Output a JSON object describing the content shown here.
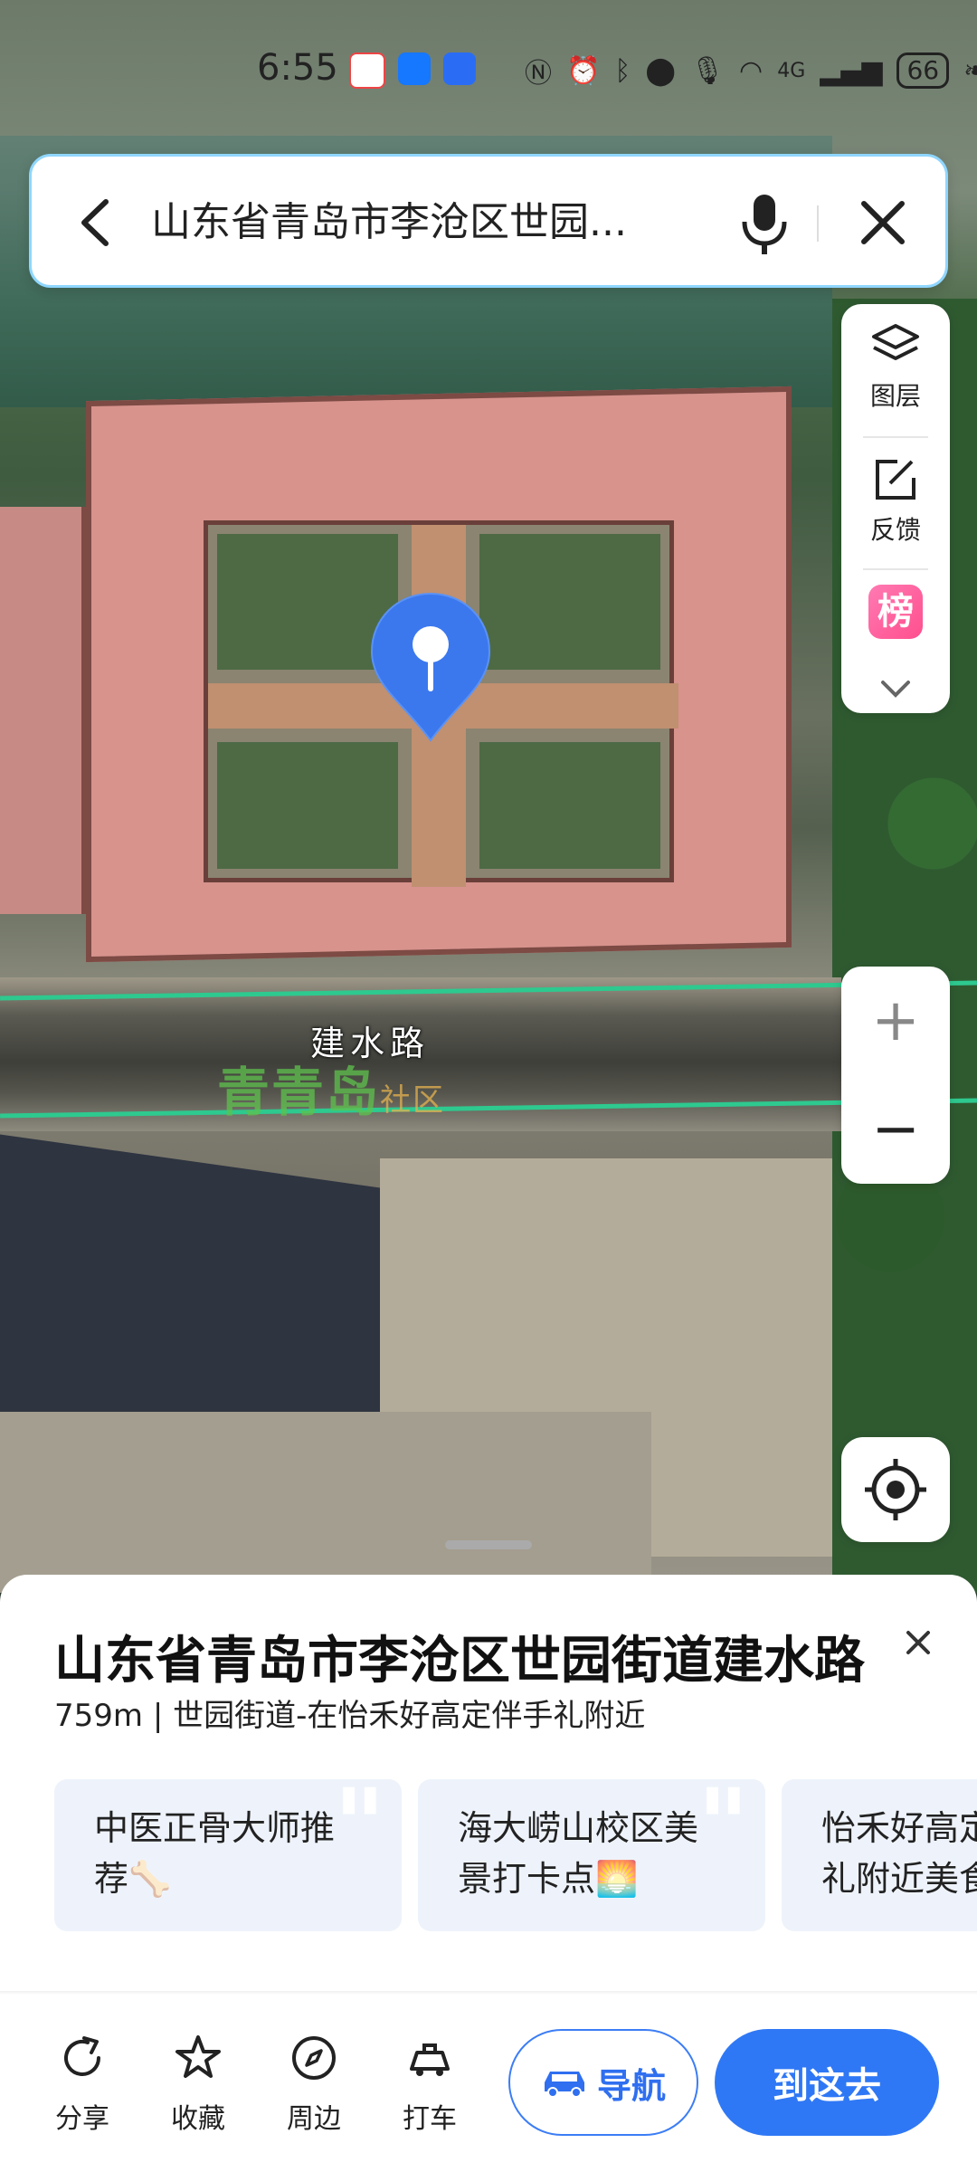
{
  "status_bar": {
    "time": "6:55",
    "network": "4G",
    "battery": "66"
  },
  "search": {
    "query": "山东省青岛市李沧区世园...",
    "back_icon": "chevron-left-icon",
    "voice_icon": "microphone-icon",
    "clear_icon": "close-icon"
  },
  "map": {
    "road_label": "建水路",
    "watermark_main": "青青岛",
    "watermark_small": "社区"
  },
  "tools": {
    "layers_label": "图层",
    "feedback_label": "反馈",
    "rank_badge": "榜"
  },
  "zoom": {
    "in": "+",
    "out": "−"
  },
  "poi": {
    "title": "山东省青岛市李沧区世园街道建水路",
    "subtitle": "759m | 世园街道-在怡禾好高定伴手礼附近",
    "cards": [
      {
        "text": "中医正骨大师推荐🦴"
      },
      {
        "text": "海大崂山校区美景打卡点🌅"
      },
      {
        "text": "怡禾好高定伴手礼附近美食"
      }
    ]
  },
  "actions": {
    "share": "分享",
    "favorite": "收藏",
    "nearby": "周边",
    "taxi": "打车",
    "navigate": "导航",
    "go_here": "到这去"
  },
  "colors": {
    "accent": "#2f78f5",
    "route_line": "#2ec98f",
    "rank_pink": "#ff4f8e"
  }
}
